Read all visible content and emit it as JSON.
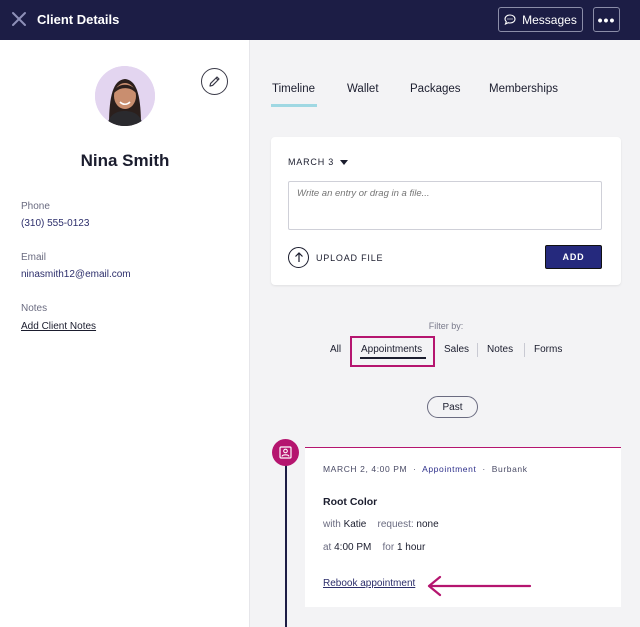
{
  "header": {
    "title": "Client Details",
    "messages_label": "Messages",
    "more_label": "•••"
  },
  "client": {
    "name": "Nina Smith",
    "phone_label": "Phone",
    "phone": "(310) 555-0123",
    "email_label": "Email",
    "email": "ninasmith12@email.com",
    "notes_label": "Notes",
    "add_notes_link": "Add Client Notes"
  },
  "tabs": [
    {
      "label": "Timeline",
      "active": true
    },
    {
      "label": "Wallet"
    },
    {
      "label": "Packages"
    },
    {
      "label": "Memberships"
    }
  ],
  "entry": {
    "date": "MARCH 3",
    "placeholder": "Write an entry or drag in a file...",
    "upload_label": "UPLOAD FILE",
    "add_label": "ADD"
  },
  "filter": {
    "label": "Filter by:",
    "options": [
      "All",
      "Appointments",
      "Sales",
      "Notes",
      "Forms"
    ],
    "selected": "Appointments"
  },
  "past_label": "Past",
  "appointment": {
    "datetime": "MARCH 2, 4:00 PM",
    "type": "Appointment",
    "location": "Burbank",
    "sep": "·",
    "service": "Root Color",
    "with_label": "with",
    "staff": "Katie",
    "request_label": "request:",
    "request": "none",
    "at_label": "at",
    "time": "4:00 PM",
    "for_label": "for",
    "duration": "1 hour",
    "rebook_label": "Rebook appointment"
  },
  "colors": {
    "navy": "#1c1d45",
    "accent": "#b5156f",
    "button": "#25297d",
    "tab_underline": "#9fd8e3"
  }
}
